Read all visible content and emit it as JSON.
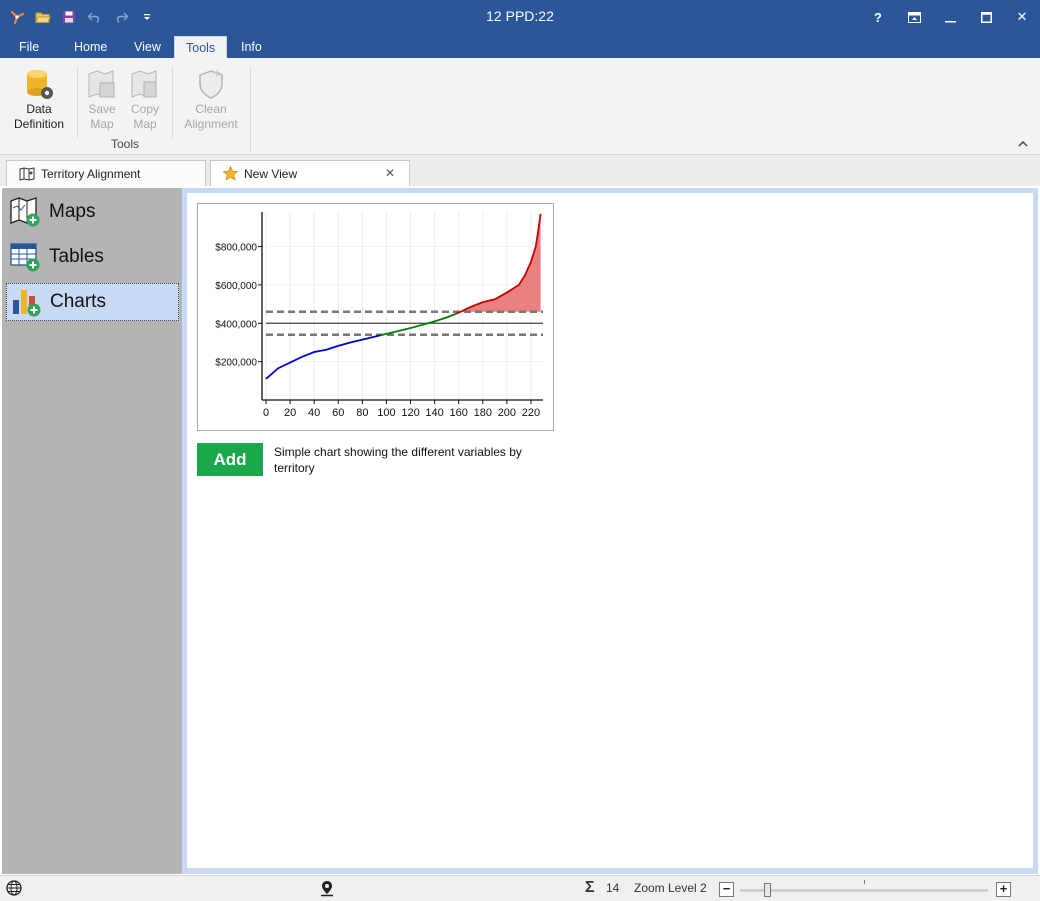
{
  "window": {
    "title": "12 PPD:22"
  },
  "qat": {
    "icons": [
      "app-logo-icon",
      "open-folder-icon",
      "save-icon",
      "undo-icon",
      "redo-icon",
      "customize-qat-icon"
    ]
  },
  "winctl": {
    "help": "?",
    "close": "✕",
    "maximize": "☐",
    "minimize": "—"
  },
  "tabs": [
    {
      "label": "File"
    },
    {
      "label": "Home"
    },
    {
      "label": "View"
    },
    {
      "label": "Tools"
    },
    {
      "label": "Info"
    }
  ],
  "ribbon": {
    "data_definition": {
      "line1": "Data",
      "line2": "Definition"
    },
    "save_map": {
      "line1": "Save",
      "line2": "Map"
    },
    "copy_map": {
      "line1": "Copy",
      "line2": "Map"
    },
    "clean_alignment": {
      "line1": "Clean",
      "line2": "Alignment"
    },
    "group_label": "Tools"
  },
  "doctabs": [
    {
      "label": "Territory Alignment"
    },
    {
      "label": "New View"
    }
  ],
  "sidebar": {
    "items": [
      {
        "label": "Maps"
      },
      {
        "label": "Tables"
      },
      {
        "label": "Charts"
      }
    ]
  },
  "card": {
    "add_label": "Add",
    "description": "Simple chart showing the different variables by territory"
  },
  "status": {
    "count": "14",
    "zoom_label": "Zoom Level 2",
    "zoom_level": 0.11,
    "minus": "−",
    "plus": "+"
  },
  "colors": {
    "titlebar": "#2b579a",
    "accent": "#1aa84a",
    "selected": "#c7d9f3",
    "low": "#0000cc",
    "mid": "#008000",
    "high": "#cc0000",
    "high_fill": "#e98080"
  },
  "chart_data": {
    "type": "line",
    "x": [
      0,
      10,
      20,
      30,
      40,
      50,
      60,
      70,
      80,
      90,
      100,
      110,
      120,
      130,
      140,
      150,
      160,
      170,
      180,
      190,
      200,
      210,
      215,
      220,
      224,
      226,
      228
    ],
    "y": [
      110000,
      165000,
      195000,
      225000,
      250000,
      262000,
      282000,
      300000,
      315000,
      330000,
      345000,
      360000,
      375000,
      392000,
      410000,
      430000,
      455000,
      485000,
      510000,
      525000,
      560000,
      600000,
      650000,
      720000,
      800000,
      880000,
      970000
    ],
    "segments": [
      {
        "name": "",
        "x_range": [
          0,
          95
        ],
        "color": "#0000cc"
      },
      {
        "name": "",
        "x_range": [
          95,
          158
        ],
        "color": "#008000"
      },
      {
        "name": "",
        "x_range": [
          158,
          228
        ],
        "color": "#cc0000",
        "fill": true
      }
    ],
    "reference_lines": [
      {
        "y": 460000,
        "style": "dashed"
      },
      {
        "y": 400000,
        "style": "solid"
      },
      {
        "y": 340000,
        "style": "dashed"
      }
    ],
    "x_ticks": [
      "0",
      "20",
      "40",
      "60",
      "80",
      "100",
      "120",
      "140",
      "160",
      "180",
      "200",
      "220"
    ],
    "y_ticks": [
      "$200,000",
      "$400,000",
      "$600,000",
      "$800,000"
    ],
    "xlim": [
      0,
      230
    ],
    "ylim": [
      0,
      980000
    ],
    "title": "",
    "xlabel": "",
    "ylabel": "",
    "grid": "vertical"
  }
}
